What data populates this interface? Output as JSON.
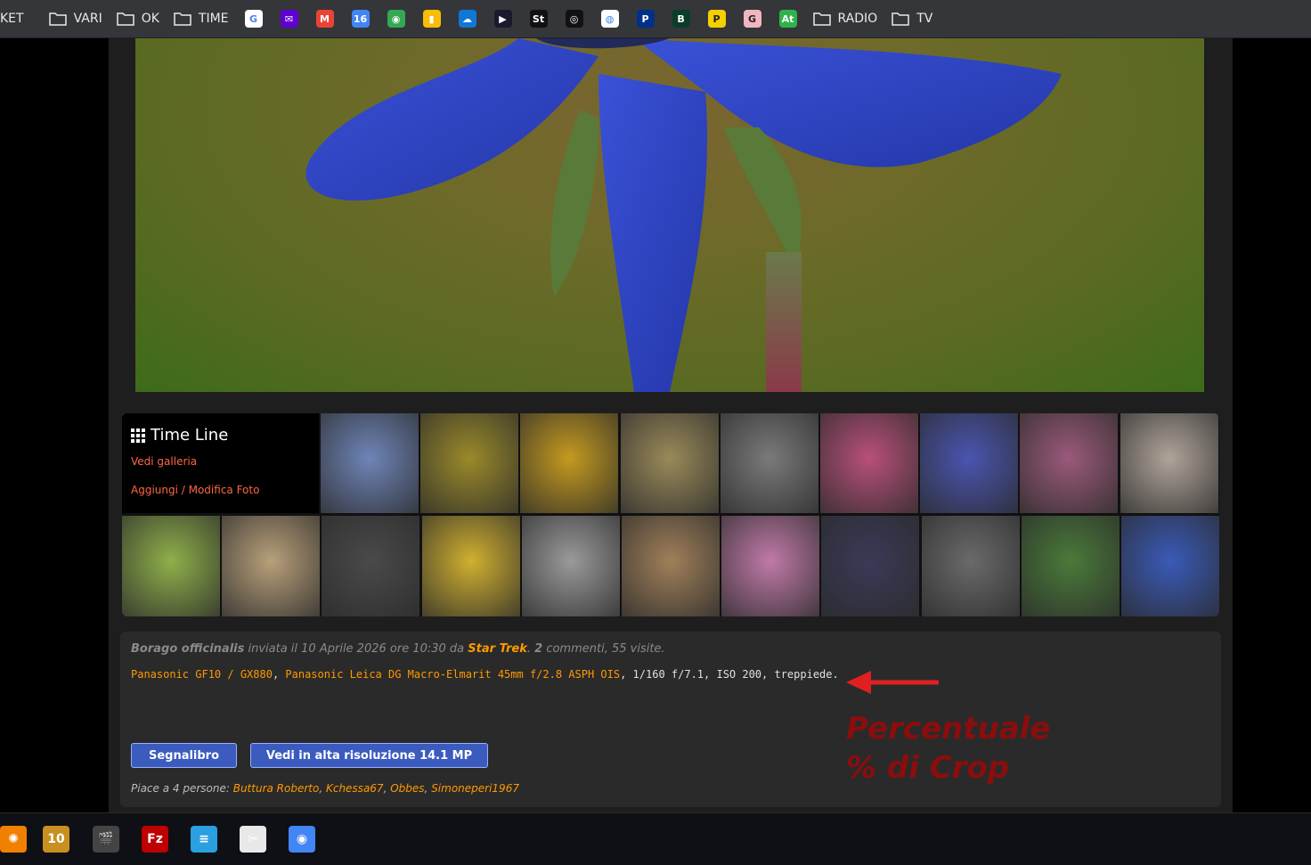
{
  "bookmarks": {
    "partial_label": "KET",
    "folders": [
      "VARI",
      "OK",
      "TIME",
      "RADIO",
      "TV"
    ],
    "icons": [
      {
        "name": "google-icon",
        "glyph": "G",
        "color": "#ffffff"
      },
      {
        "name": "yahoo-mail-icon",
        "glyph": "✉",
        "color": "#5f01d1"
      },
      {
        "name": "gmail-icon",
        "glyph": "M",
        "color": "#ea4335"
      },
      {
        "name": "calendar-icon",
        "glyph": "16",
        "color": "#4285f4"
      },
      {
        "name": "maps-icon",
        "glyph": "◉",
        "color": "#34a853"
      },
      {
        "name": "keep-icon",
        "glyph": "▮",
        "color": "#fbbc04"
      },
      {
        "name": "onedrive-icon",
        "glyph": "☁",
        "color": "#0f78d4"
      },
      {
        "name": "play-icon",
        "glyph": "▶",
        "color": "#1a1a2e"
      },
      {
        "name": "st-icon",
        "glyph": "St",
        "color": "#111111"
      },
      {
        "name": "squarespace-icon",
        "glyph": "◎",
        "color": "#111111"
      },
      {
        "name": "globe-icon",
        "glyph": "◍",
        "color": "#ffffff"
      },
      {
        "name": "paypal-icon",
        "glyph": "P",
        "color": "#003087"
      },
      {
        "name": "b-icon",
        "glyph": "B",
        "color": "#0a3d2a"
      },
      {
        "name": "p-yellow-icon",
        "glyph": "P",
        "color": "#f5d000"
      },
      {
        "name": "g-pink-icon",
        "glyph": "G",
        "color": "#f3b6c0"
      },
      {
        "name": "at-icon",
        "glyph": "At",
        "color": "#2db34a"
      }
    ]
  },
  "timeline": {
    "title": "Time Line",
    "link_gallery": "Vedi galleria",
    "link_manage": "Aggiungi / Modifica Foto",
    "thumbnails_row1": [
      {
        "name": "thumb-veronica-blue",
        "color": "#6f85b8"
      },
      {
        "name": "thumb-moss-capsules",
        "color": "#9a8a2a"
      },
      {
        "name": "thumb-yellow-flowers",
        "color": "#c49a1f"
      },
      {
        "name": "thumb-snowflake-flower",
        "color": "#9a8a5a"
      },
      {
        "name": "thumb-street-bw",
        "color": "#7a7a7a"
      },
      {
        "name": "thumb-pink-geranium",
        "color": "#b8507a"
      },
      {
        "name": "thumb-grape-hyacinth",
        "color": "#4a55b0"
      },
      {
        "name": "thumb-purple-deadnettle",
        "color": "#9a5a7a"
      },
      {
        "name": "thumb-field-mountains",
        "color": "#b0a49a"
      }
    ],
    "thumbnails_row2": [
      {
        "name": "thumb-red-machine-trees",
        "color": "#8fb04a"
      },
      {
        "name": "thumb-village-houses",
        "color": "#b8a07a"
      },
      {
        "name": "thumb-hooded-person-bw",
        "color": "#4a4a4a"
      },
      {
        "name": "thumb-yellow-daffodil",
        "color": "#d0b030"
      },
      {
        "name": "thumb-bicycle-wheel-bw",
        "color": "#9a9a9a"
      },
      {
        "name": "thumb-plant-on-wall",
        "color": "#a0805a"
      },
      {
        "name": "thumb-pink-orchid",
        "color": "#c07aa8"
      },
      {
        "name": "thumb-borage-dark",
        "color": "#3a3a58"
      },
      {
        "name": "thumb-playground-bw",
        "color": "#6a6a6a"
      },
      {
        "name": "thumb-veronica-leaves",
        "color": "#4a7a3a"
      },
      {
        "name": "thumb-borage-blue",
        "color": "#3a5ab8"
      }
    ]
  },
  "info": {
    "title": "Borago officinalis",
    "sent_text": " inviata il 10 Aprile 2026 ore 10:30 da ",
    "author": "Star Trek",
    "stats_prefix": ". ",
    "comments_count": "2",
    "stats_text": " commenti, 55 visite.",
    "camera": "Panasonic GF10 / GX880",
    "lens": "Panasonic Leica DG Macro-Elmarit 45mm f/2.8 ASPH OIS",
    "settings": ", 1/160 f/7.1, ISO 200, treppiede.",
    "bookmark_button": "Segnalibro",
    "hires_button": "Vedi in alta risoluzione 14.1 MP",
    "likes_prefix": "Piace a 4 persone: ",
    "likers": [
      "Buttura Roberto",
      "Kchessa67",
      "Obbes",
      "Simoneperi1967"
    ]
  },
  "annotation": {
    "line1": "Percentuale",
    "line2": "% di Crop",
    "color": "#8b0d0d"
  },
  "taskbar": {
    "apps": [
      {
        "name": "xnview-icon",
        "glyph": "✺",
        "color": "#f08000"
      },
      {
        "name": "windows10-shield-icon",
        "glyph": "10",
        "color": "#c89020"
      },
      {
        "name": "video-clapper-icon",
        "glyph": "🎬",
        "color": "#444444"
      },
      {
        "name": "filezilla-icon",
        "glyph": "Fz",
        "color": "#bf0000"
      },
      {
        "name": "notepad-icon",
        "glyph": "≡",
        "color": "#2aa0e0"
      },
      {
        "name": "snipping-tool-icon",
        "glyph": "✂",
        "color": "#e8e8e8"
      },
      {
        "name": "chrome-icon",
        "glyph": "◉",
        "color": "#4285f4"
      }
    ]
  }
}
